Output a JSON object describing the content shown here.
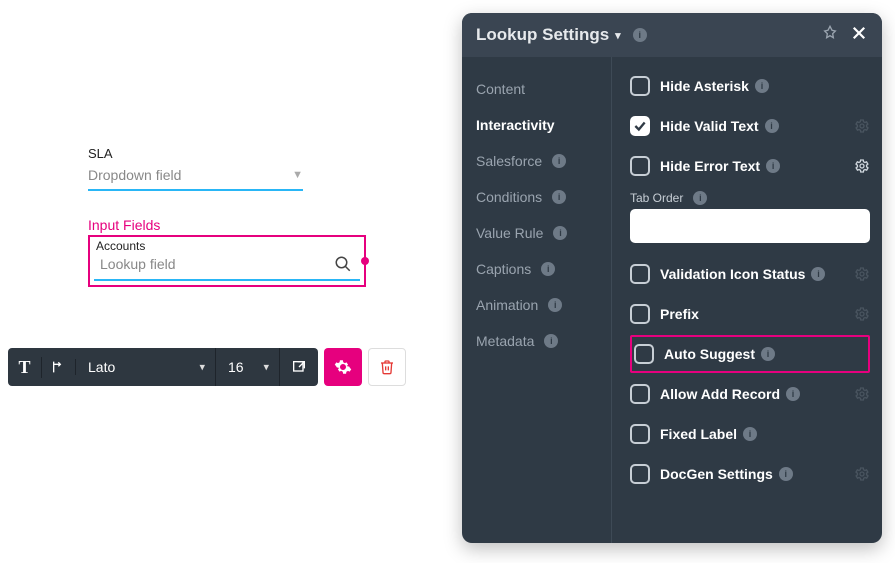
{
  "canvas": {
    "sla_label": "SLA",
    "dropdown_placeholder": "Dropdown field",
    "input_fields_header": "Input Fields",
    "lookup_block_label": "Accounts",
    "lookup_placeholder": "Lookup field"
  },
  "toolbar": {
    "font_family": "Lato",
    "font_size": "16"
  },
  "panel": {
    "title": "Lookup Settings",
    "nav": {
      "content": "Content",
      "interactivity": "Interactivity",
      "salesforce": "Salesforce",
      "conditions": "Conditions",
      "value_rule": "Value Rule",
      "captions": "Captions",
      "animation": "Animation",
      "metadata": "Metadata"
    },
    "tab_order_label": "Tab Order",
    "tab_order_value": "",
    "props": {
      "hide_asterisk": "Hide Asterisk",
      "hide_valid_text": "Hide Valid Text",
      "hide_error_text": "Hide Error Text",
      "validation_icon_status": "Validation Icon Status",
      "prefix": "Prefix",
      "auto_suggest": "Auto Suggest",
      "allow_add_record": "Allow Add Record",
      "fixed_label": "Fixed Label",
      "docgen_settings": "DocGen Settings"
    }
  }
}
